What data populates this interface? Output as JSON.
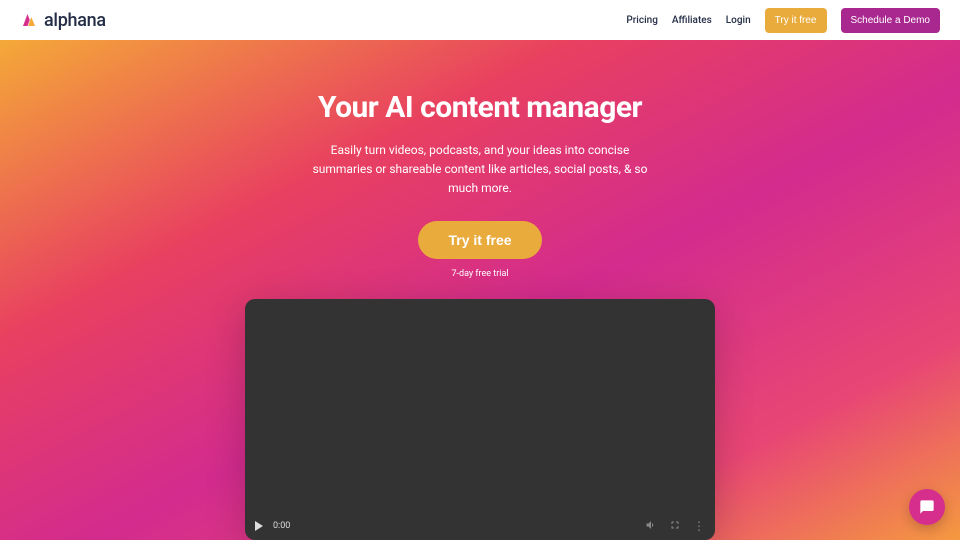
{
  "header": {
    "logo_text": "alphana",
    "nav": {
      "pricing": "Pricing",
      "affiliates": "Affiliates",
      "login": "Login",
      "try_free": "Try it free",
      "schedule_demo": "Schedule a Demo"
    }
  },
  "hero": {
    "title": "Your AI content manager",
    "subtitle": "Easily turn videos, podcasts, and your ideas into concise summaries or shareable content like articles, social posts, & so much more.",
    "cta_button": "Try it free",
    "trial_text": "7-day free trial"
  },
  "video": {
    "time": "0:00"
  }
}
